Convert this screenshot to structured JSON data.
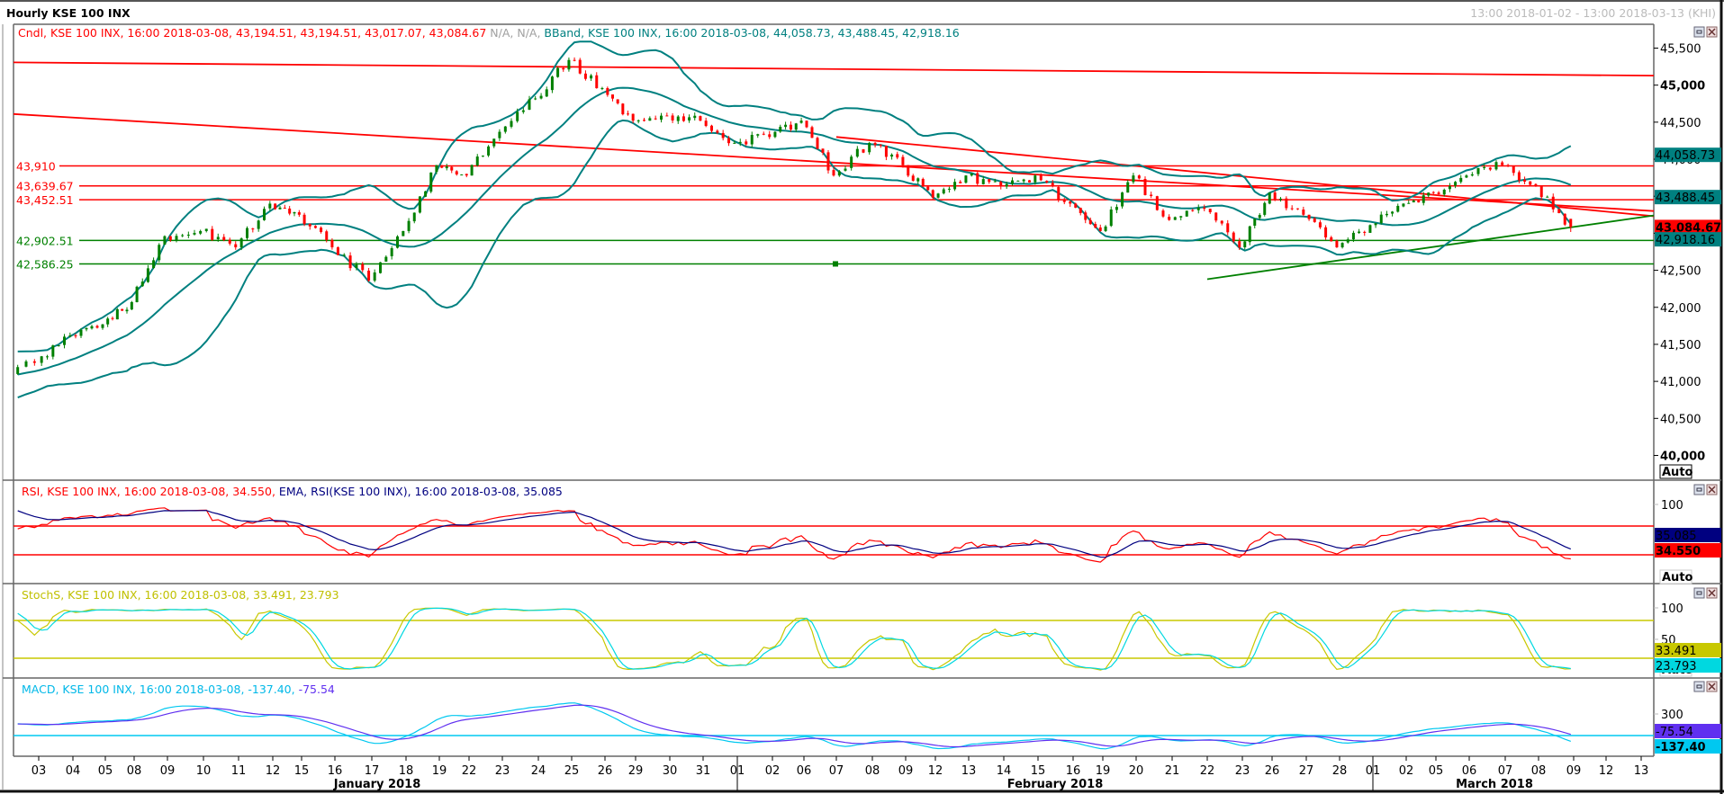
{
  "window": {
    "title": "Hourly KSE 100 INX",
    "range": "13:00 2018-01-02 - 13:00 2018-03-13 (KHI)"
  },
  "legends": {
    "candle": "Cndl, KSE 100 INX, 16:00 2018-03-08, 43,194.51, 43,194.51, 43,017.07, 43,084.67",
    "na": "N/A, N/A,",
    "bband": "BBand, KSE 100 INX, 16:00 2018-03-08, 44,058.73, 43,488.45, 42,918.16",
    "rsi": "RSI, KSE 100 INX, 16:00 2018-03-08, 34.550,",
    "ema": "EMA, RSI(KSE 100 INX), 16:00 2018-03-08, 35.085",
    "stoch": "StochS, KSE 100 INX, 16:00 2018-03-08, 33.491, 23.793",
    "macd": "MACD, KSE 100 INX, 16:00 2018-03-08, -137.40,",
    "macd_signal": "-75.54"
  },
  "colors": {
    "up": "#008000",
    "down": "#ff0000",
    "bband": "#008080",
    "rsi": "#ff0000",
    "ema": "#000080",
    "stoch_k": "#c8c800",
    "stoch_d": "#00d8e0",
    "macd": "#00c8f0",
    "macd_signal": "#6030f0"
  },
  "axis": {
    "price_ticks": [
      "45,500",
      "45,000",
      "44,500",
      "44,000",
      "43,500",
      "43,000",
      "42,500",
      "42,000",
      "41,500",
      "41,000",
      "40,500",
      "40,000"
    ],
    "auto": "Auto",
    "rsi_tick": "100",
    "stoch_ticks": [
      "100",
      "50"
    ],
    "macd_tick": "300",
    "months": [
      "January 2018",
      "February 2018",
      "March 2018"
    ]
  },
  "readouts": {
    "bb_upper": "44,058.73",
    "bb_mid": "43,488.45",
    "close": "43,084.67",
    "bb_lower": "42,918.16",
    "ema": "35.085",
    "rsi": "34.550",
    "stoch_k": "33.491",
    "stoch_d": "23.793",
    "macd_signal": "-75.54",
    "macd": "-137.40"
  },
  "chart_data": {
    "type": "candlestick",
    "title": "Hourly KSE 100 INX",
    "symbol": "KSE 100 INX",
    "ylim": [
      39700,
      45800
    ],
    "x_labels": [
      "03",
      "04",
      "05",
      "08",
      "09",
      "10",
      "11",
      "12",
      "15",
      "16",
      "17",
      "18",
      "19",
      "22",
      "23",
      "24",
      "25",
      "26",
      "29",
      "30",
      "31",
      "01",
      "02",
      "06",
      "07",
      "08",
      "09",
      "12",
      "13",
      "14",
      "15",
      "16",
      "19",
      "20",
      "21",
      "22",
      "23",
      "26",
      "27",
      "28",
      "01",
      "02",
      "05",
      "06",
      "07",
      "08",
      "09",
      "12",
      "13"
    ],
    "trading_days": [
      "2018-01-02",
      "2018-01-03",
      "2018-01-04",
      "2018-01-05",
      "2018-01-08",
      "2018-01-09",
      "2018-01-10",
      "2018-01-11",
      "2018-01-12",
      "2018-01-15",
      "2018-01-16",
      "2018-01-17",
      "2018-01-18",
      "2018-01-19",
      "2018-01-22",
      "2018-01-23",
      "2018-01-24",
      "2018-01-25",
      "2018-01-26",
      "2018-01-29",
      "2018-01-30",
      "2018-01-31",
      "2018-02-01",
      "2018-02-02",
      "2018-02-06",
      "2018-02-07",
      "2018-02-08",
      "2018-02-09",
      "2018-02-12",
      "2018-02-13",
      "2018-02-14",
      "2018-02-15",
      "2018-02-16",
      "2018-02-19",
      "2018-02-20",
      "2018-02-21",
      "2018-02-22",
      "2018-02-23",
      "2018-02-26",
      "2018-02-27",
      "2018-02-28",
      "2018-03-01",
      "2018-03-02",
      "2018-03-05",
      "2018-03-06",
      "2018-03-07",
      "2018-03-08",
      "2018-03-09",
      "2018-03-12",
      "2018-03-13"
    ],
    "daily_close_approx": [
      41250,
      41620,
      41770,
      42070,
      42960,
      43030,
      42810,
      43400,
      43250,
      42810,
      42360,
      43030,
      43920,
      43780,
      44370,
      44820,
      45340,
      44960,
      44520,
      44590,
      44520,
      44220,
      44300,
      44520,
      43780,
      44220,
      43920,
      43480,
      43780,
      43630,
      43780,
      43400,
      43030,
      43780,
      43180,
      43330,
      42810,
      43550,
      43250,
      42810,
      43110,
      43400,
      43550,
      43780,
      43920,
      43630,
      43084.67
    ],
    "last_bar": {
      "time": "16:00 2018-03-08",
      "open": 43194.51,
      "high": 43194.51,
      "low": 43017.07,
      "close": 43084.67
    },
    "bollinger_last": {
      "upper": 44058.73,
      "middle": 43488.45,
      "lower": 42918.16
    },
    "horizontal_levels": [
      {
        "label": "43,910",
        "value": 43910,
        "color": "#ff0000"
      },
      {
        "label": "43,639.67",
        "value": 43639.67,
        "color": "#ff0000"
      },
      {
        "label": "43,452.51",
        "value": 43452.51,
        "color": "#ff0000"
      },
      {
        "label": "42,902.51",
        "value": 42902.51,
        "color": "#008000"
      },
      {
        "label": "42,586.25",
        "value": 42586.25,
        "color": "#008000"
      }
    ],
    "trendlines": [
      {
        "from": [
          "2018-01-02",
          45307
        ],
        "to": [
          "2018-03-13",
          45128
        ],
        "color": "#ff0000"
      },
      {
        "from": [
          "2018-01-02",
          44610
        ],
        "to": [
          "2018-03-13",
          43300
        ],
        "color": "#ff0000"
      },
      {
        "from": [
          "2018-02-07",
          44300
        ],
        "to": [
          "2018-03-13",
          43230
        ],
        "color": "#ff0000"
      },
      {
        "from": [
          "2018-02-22",
          42380
        ],
        "to": [
          "2018-03-13",
          43240
        ],
        "color": "#008000"
      }
    ],
    "rsi": {
      "value": 34.55,
      "ema": 35.085,
      "levels": [
        70,
        30
      ],
      "ylim": [
        0,
        100
      ]
    },
    "stoch": {
      "k": 33.491,
      "d": 23.793,
      "levels": [
        80,
        20
      ],
      "ylim": [
        0,
        100
      ]
    },
    "macd": {
      "macd": -137.4,
      "signal": -75.54
    }
  }
}
